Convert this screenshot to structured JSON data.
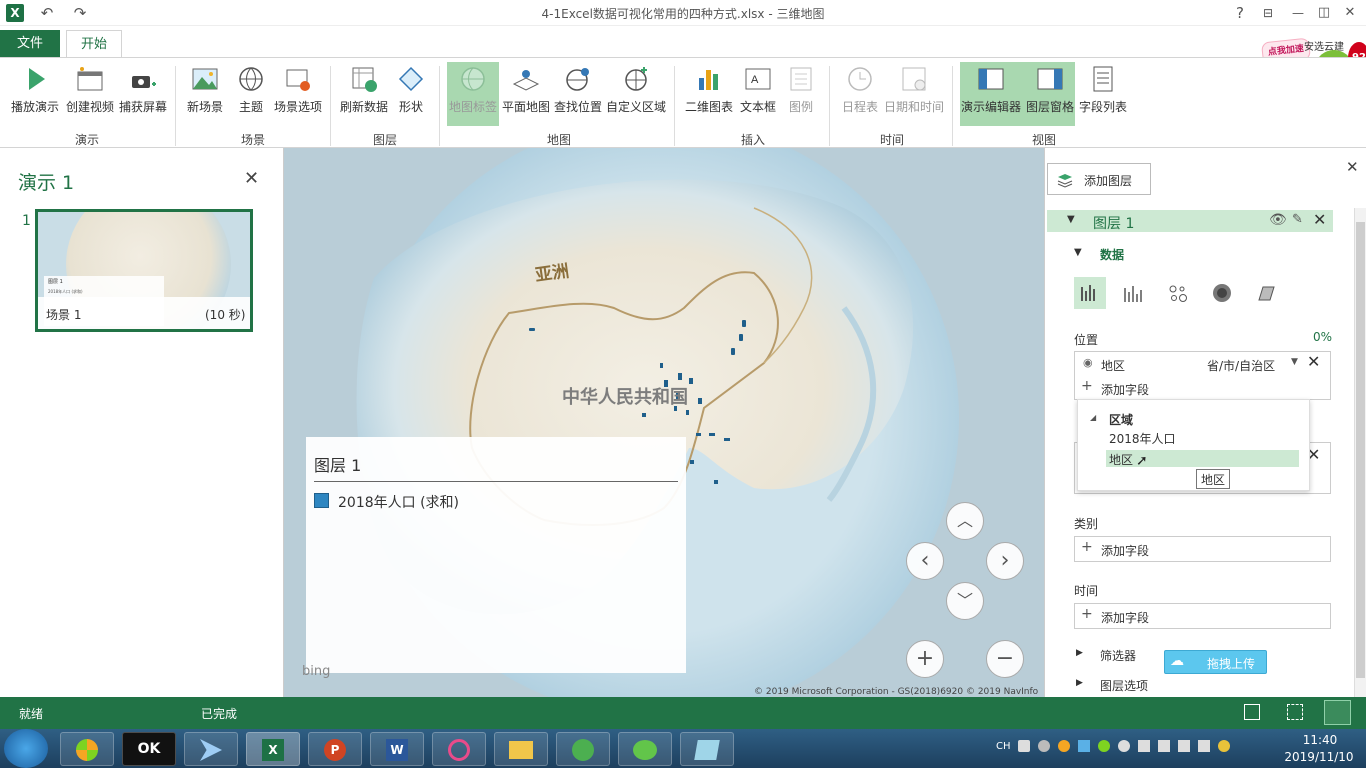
{
  "window": {
    "title": "4-1Excel数据可视化常用的四种方式.xlsx - 三维地图",
    "help": "?",
    "restore": "⊟",
    "minimize": "—",
    "maximize": "◫",
    "close": "✕"
  },
  "tabs": {
    "file": "文件",
    "home": "开始"
  },
  "ribbon": {
    "buttons": {
      "play_tour": "播放演示",
      "create_video": "创建视频",
      "capture_screen": "捕获屏幕",
      "new_scene": "新场景",
      "theme": "主题",
      "scene_options": "场景选项",
      "refresh_data": "刷新数据",
      "shapes": "形状",
      "map_labels": "地图标签",
      "flat_map": "平面地图",
      "find_location": "查找位置",
      "custom_regions": "自定义区域",
      "chart_2d": "二维图表",
      "text_box": "文本框",
      "legend": "图例",
      "timeline": "日程表",
      "date_time": "日期和时间",
      "tour_editor": "演示编辑器",
      "layer_pane": "图层窗格",
      "field_list": "字段列表"
    },
    "groups": {
      "tour": "演示",
      "scene": "场景",
      "layer": "图层",
      "map": "地图",
      "insert": "插入",
      "time": "时间",
      "view": "视图"
    }
  },
  "ad": {
    "text": "点我加速",
    "badge": "92",
    "extra": "安选云建"
  },
  "tour_panel": {
    "title": "演示 1",
    "close": "✕",
    "scene_number": "1",
    "scene_name": "场景 1",
    "scene_duration": "(10 秒)",
    "thumb_layer": "图层 1",
    "thumb_series": "2018年人口 (求和)"
  },
  "map": {
    "continent_label": "亚洲",
    "country_label": "中华人民共和国",
    "legend_title": "图层 1",
    "legend_item": "2018年人口 (求和)",
    "legend_color": "#2e86c1",
    "bing": "bing",
    "copyright": "© 2019 Microsoft Corporation - GS(2018)6920  © 2019 NavInfo",
    "nav": {
      "up": "︿",
      "down": "﹀",
      "left": "‹",
      "right": "›",
      "zoom_in": "+",
      "zoom_out": "−"
    }
  },
  "layer_pane": {
    "close": "✕",
    "add_layer": "添加图层",
    "layer_name": "图层 1",
    "data_section": "数据",
    "location_label": "位置",
    "location_percent": "0%",
    "location_field": "地区",
    "location_type": "省/市/自治区",
    "add_field": "添加字段",
    "dropdown": {
      "group": "区域",
      "item1": "2018年人口",
      "item2": "地区"
    },
    "tooltip": "地区",
    "category_label": "类别",
    "time_label": "时间",
    "filters": "筛选器",
    "layer_options": "图层选项",
    "upload": "拖拽上传"
  },
  "status": {
    "ready": "就绪",
    "done": "已完成"
  },
  "taskbar": {
    "lang": "CH",
    "time": "11:40",
    "date": "2019/11/10"
  }
}
